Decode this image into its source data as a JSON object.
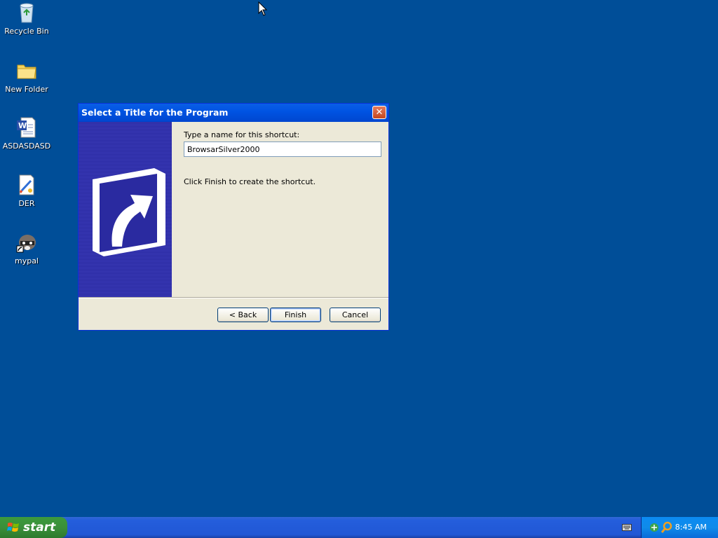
{
  "desktop": {
    "icons": [
      {
        "label": "Recycle Bin",
        "icon": "recycle-bin-icon"
      },
      {
        "label": "New Folder",
        "icon": "folder-icon"
      },
      {
        "label": "ASDASDASD",
        "icon": "word-document-icon"
      },
      {
        "label": "DER",
        "icon": "paint-file-icon"
      },
      {
        "label": "mypal",
        "icon": "raccoon-shortcut-icon"
      }
    ]
  },
  "dialog": {
    "title": "Select a Title for the Program",
    "close_label": "✕",
    "prompt": "Type a name for this shortcut:",
    "name_value": "BrowsarSilver2000",
    "hint": "Click Finish to create the shortcut.",
    "back_label": "< Back",
    "finish_label": "Finish",
    "cancel_label": "Cancel",
    "side_icon": "shortcut-arrow-icon"
  },
  "taskbar": {
    "start_label": "start",
    "clock": "8:45 AM",
    "tray_icons": [
      "keyboard-icon",
      "network-icon",
      "search-icon"
    ]
  },
  "colors": {
    "desktop": "#004e98",
    "titlebar": "#0054e3",
    "dialog_bg": "#ece9d8",
    "side_panel": "#2f2fa8"
  }
}
